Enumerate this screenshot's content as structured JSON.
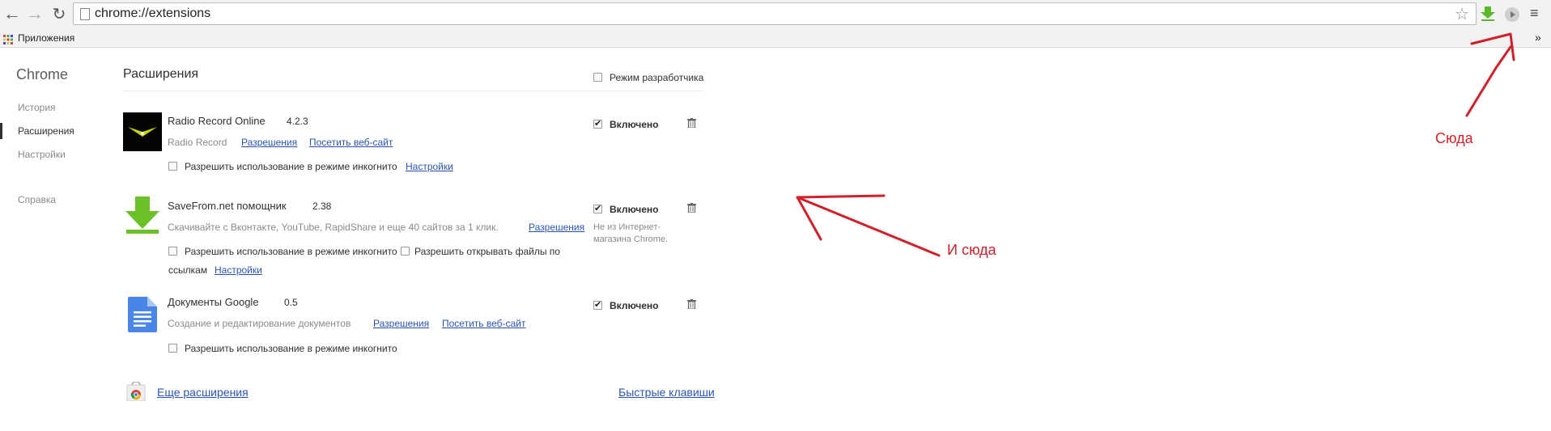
{
  "browser": {
    "url": "chrome://extensions",
    "bookmarks_apps": "Приложения",
    "bookmarks_more": "»"
  },
  "sidebar": {
    "title": "Chrome",
    "items": [
      {
        "label": "История"
      },
      {
        "label": "Расширения"
      },
      {
        "label": "Настройки"
      },
      {
        "label": "Справка"
      }
    ]
  },
  "header": {
    "title": "Расширения",
    "dev_mode": "Режим разработчика"
  },
  "extensions": [
    {
      "name": "Radio Record Online",
      "version": "4.2.3",
      "description": "Radio Record",
      "permissions": "Разрешения",
      "visit": "Посетить веб-сайт",
      "incognito": "Разрешить использование в режиме инкогнито",
      "options": "Настройки",
      "enabled": "Включено"
    },
    {
      "name": "SaveFrom.net помощник",
      "version": "2.38",
      "description": "Скачивайте с Вконтакте, YouTube, RapidShare и еще 40 сайтов за 1 клик.",
      "permissions": "Разрешения",
      "incognito": "Разрешить использование в режиме инкогнито",
      "file_access": "Разрешить открывать файлы по",
      "file_access_2": "ссылкам",
      "options": "Настройки",
      "enabled": "Включено",
      "note_1": "Не из Интернет-",
      "note_2": "магазина Chrome."
    },
    {
      "name": "Документы Google",
      "version": "0.5",
      "description": "Создание и редактирование документов",
      "permissions": "Разрешения",
      "visit": "Посетить веб-сайт",
      "incognito": "Разрешить использование в режиме инкогнито",
      "enabled": "Включено"
    }
  ],
  "footer": {
    "more": "Еще расширения",
    "shortcuts": "Быстрые клавиши"
  },
  "annotations": {
    "here": "Сюда",
    "and_here": "И сюда",
    "color": "#d1202a"
  }
}
